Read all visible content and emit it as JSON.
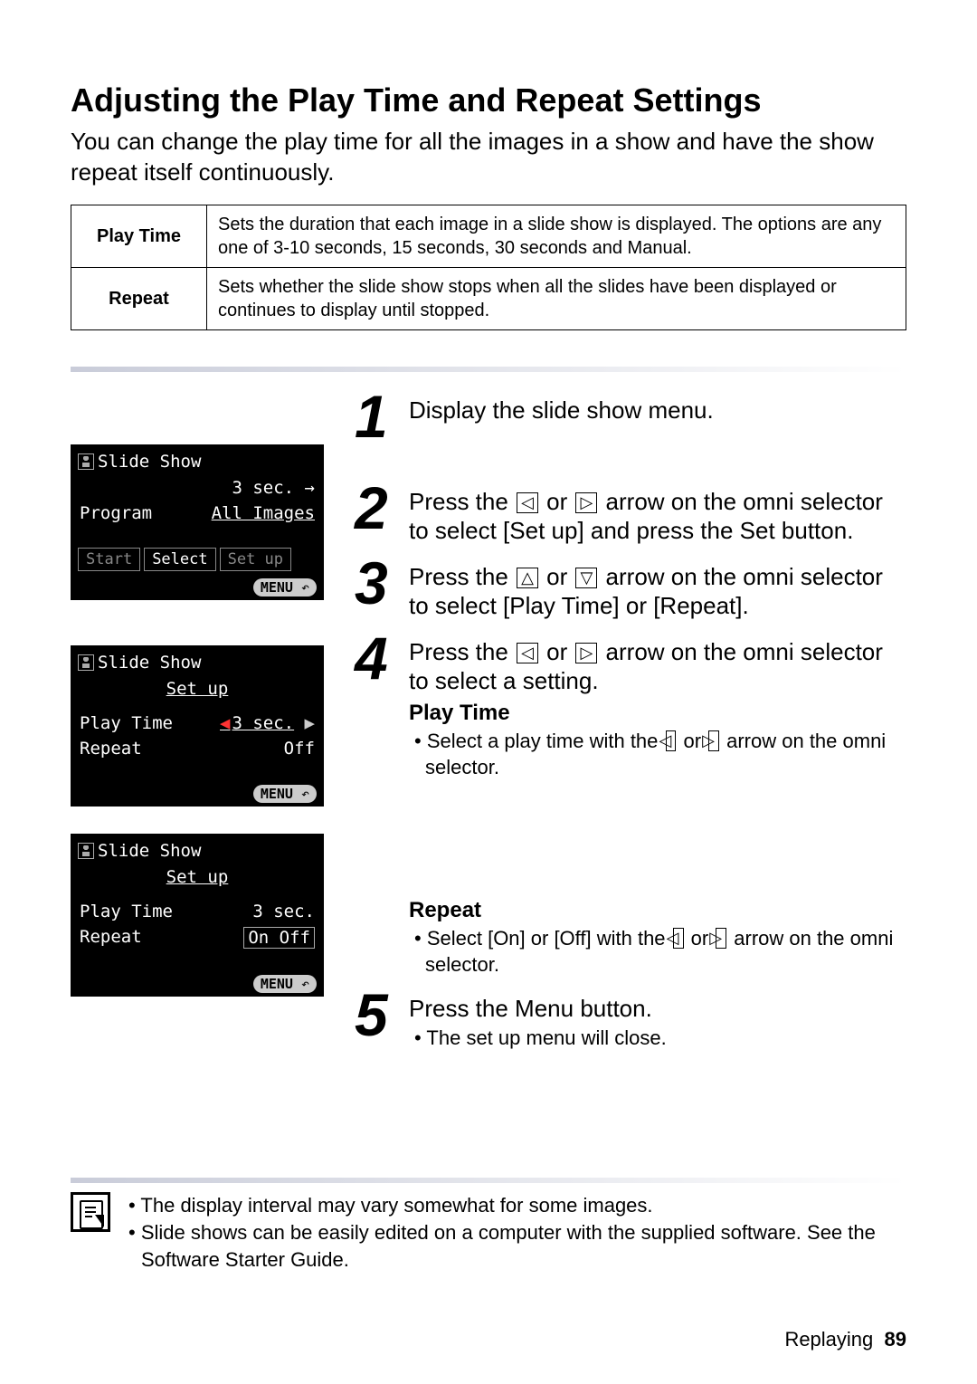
{
  "title": "Adjusting the Play Time and Repeat Settings",
  "intro": "You can change the play time for all the images in a show and have the show repeat itself continuously.",
  "settings_table": [
    {
      "label": "Play Time",
      "desc": "Sets the duration that each image in a slide show is displayed. The options are any one of 3-10 seconds, 15 seconds, 30 seconds and Manual."
    },
    {
      "label": "Repeat",
      "desc": "Sets whether the slide show stops when all the slides have been displayed or continues to display until stopped."
    }
  ],
  "lcd1": {
    "title": "Slide Show",
    "time_hint": "3 sec. →",
    "program_label": "Program",
    "program_value": "All Images",
    "tabs": {
      "start": "Start",
      "select": "Select",
      "setup": "Set up"
    },
    "menu": "MENU"
  },
  "lcd2": {
    "title": "Slide Show",
    "subtitle": "Set up",
    "row1_label": "Play Time",
    "row1_value": "3 sec.",
    "row2_label": "Repeat",
    "row2_value": "Off",
    "menu": "MENU"
  },
  "lcd3": {
    "title": "Slide Show",
    "subtitle": "Set up",
    "row1_label": "Play Time",
    "row1_value": "3 sec.",
    "row2_label": "Repeat",
    "row2_value": "On Off",
    "menu": "MENU"
  },
  "steps": {
    "s1": "Display the slide show menu.",
    "s2_a": "Press the ",
    "s2_b": " or ",
    "s2_c": " arrow on the omni selector to select [Set up] and press the Set button.",
    "s3_a": "Press the ",
    "s3_b": " or ",
    "s3_c": " arrow on the omni selector to select [Play Time] or [Repeat].",
    "s4_a": "Press the ",
    "s4_b": " or ",
    "s4_c": " arrow on the omni selector to select a setting.",
    "s4_h1": "Play Time",
    "s4_li1_a": "Select a play time with the ",
    "s4_li1_b": " or ",
    "s4_li1_c": " arrow on the omni selector.",
    "s4_h2": "Repeat",
    "s4_li2_a": "Select [On] or [Off] with the ",
    "s4_li2_b": " or ",
    "s4_li2_c": " arrow on the omni selector.",
    "s5": "Press the Menu button.",
    "s5_li": "The set up menu will close."
  },
  "notes": [
    "The display interval may vary somewhat for some images.",
    "Slide shows can be easily edited on a computer with the supplied software. See the Software Starter Guide."
  ],
  "footer": {
    "section": "Replaying",
    "page": "89"
  },
  "glyphs": {
    "left": "◁",
    "right": "▷",
    "up": "△",
    "down": "▽"
  }
}
